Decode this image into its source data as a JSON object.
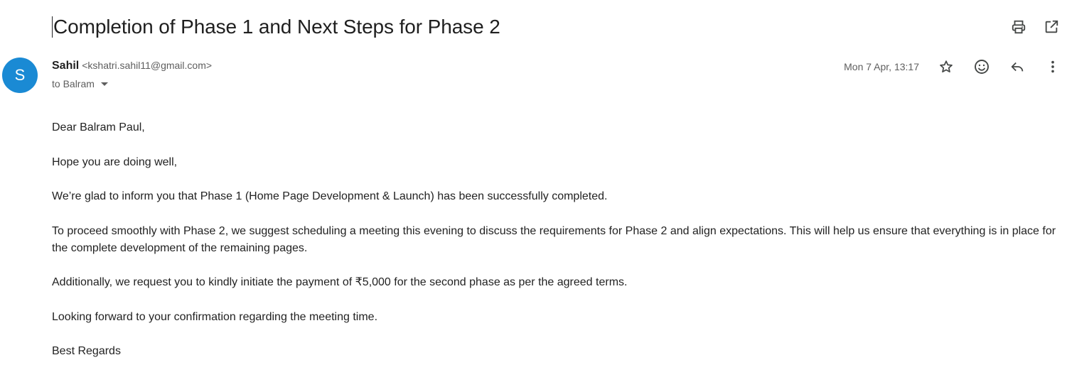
{
  "email": {
    "subject": "Completion of Phase 1 and Next Steps for Phase 2",
    "sender": {
      "avatar_letter": "S",
      "avatar_color": "#1a8ad4",
      "name": "Sahil",
      "email": "<kshatri.sahil11@gmail.com>"
    },
    "recipient_line": "to Balram",
    "timestamp": "Mon 7 Apr, 13:17",
    "body": [
      "Dear Balram Paul,",
      "Hope you are doing well,",
      "We’re glad to inform you that Phase 1 (Home Page Development & Launch) has been successfully completed.",
      "To proceed smoothly with Phase 2, we suggest scheduling a meeting this evening to discuss the requirements for Phase 2 and align expectations. This will help us ensure that everything is in place for the complete development of the remaining pages.",
      "Additionally, we request you to kindly initiate the payment of ₹5,000 for the second phase as per the agreed terms.",
      "Looking forward to your confirmation regarding the meeting time.",
      "Best Regards"
    ]
  },
  "icons": {
    "print": "print-icon",
    "open_new_window": "open-in-new-window-icon",
    "star": "star-icon",
    "emoji": "emoji-reaction-icon",
    "reply": "reply-icon",
    "more": "more-vertical-icon",
    "recipient_dropdown": "chevron-down-icon"
  }
}
